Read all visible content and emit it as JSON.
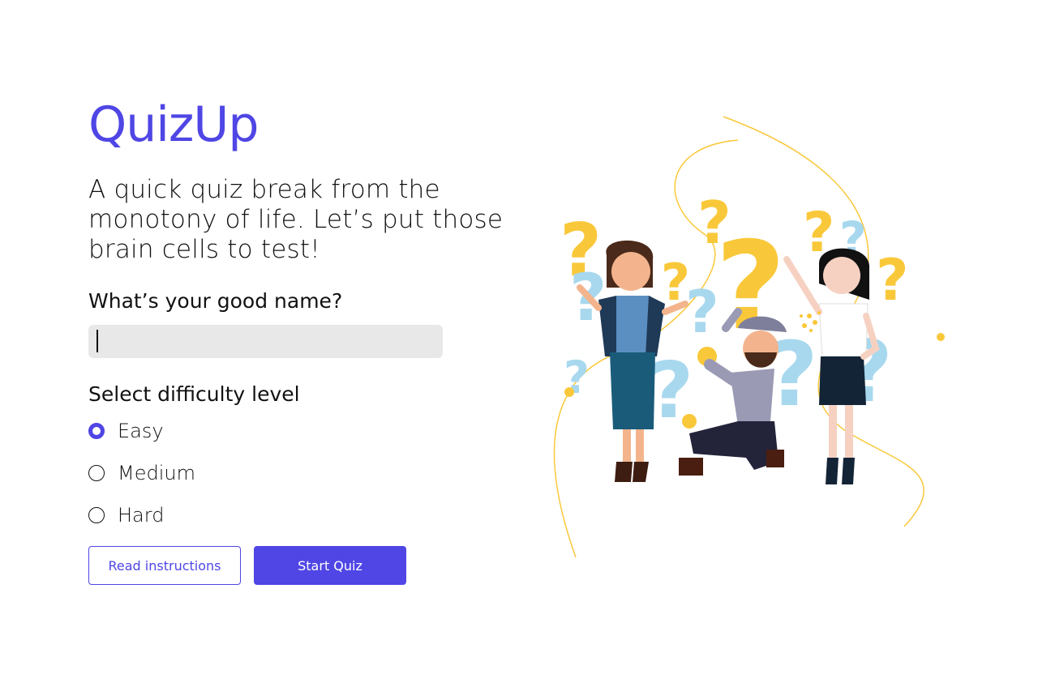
{
  "app": {
    "title": "QuizUp"
  },
  "hero": {
    "tagline": "A quick quiz break from the monotony of life. Let’s put those brain cells to test!"
  },
  "form": {
    "name_label": "What’s your good name?",
    "name_value": "",
    "difficulty_label": "Select difficulty level",
    "difficulty_options": [
      "Easy",
      "Medium",
      "Hard"
    ],
    "selected_difficulty": "Easy"
  },
  "actions": {
    "instructions_label": "Read instructions",
    "start_label": "Start Quiz"
  },
  "colors": {
    "accent": "#4f46e5",
    "input_bg": "#e8e8e8",
    "illustration_yellow": "#f9c83a",
    "illustration_lightblue": "#a8d8ee"
  }
}
